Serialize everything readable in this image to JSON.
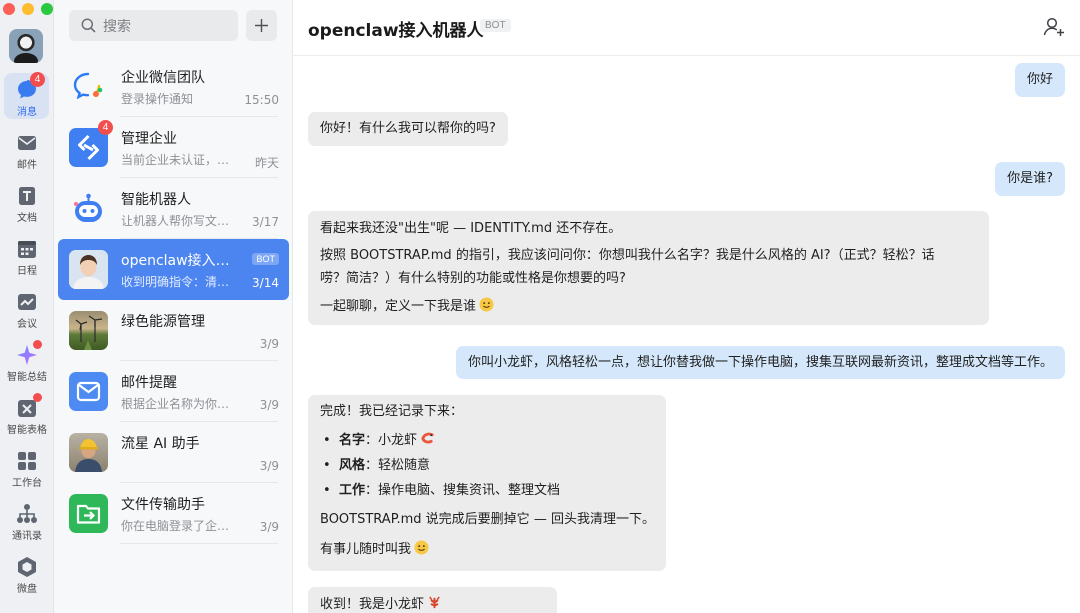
{
  "window": {
    "controls": [
      "close",
      "minimize",
      "maximize"
    ]
  },
  "nav": {
    "items": [
      {
        "id": "messages",
        "label": "消息",
        "icon": "chat-bubble-icon",
        "badge": "4",
        "active": true
      },
      {
        "id": "mail",
        "label": "邮件",
        "icon": "mail-icon"
      },
      {
        "id": "docs",
        "label": "文档",
        "icon": "document-icon"
      },
      {
        "id": "calendar",
        "label": "日程",
        "icon": "calendar-icon"
      },
      {
        "id": "meeting",
        "label": "会议",
        "icon": "meeting-icon"
      },
      {
        "id": "ai-summary",
        "label": "智能总结",
        "icon": "sparkle-icon",
        "dot": true
      },
      {
        "id": "smart-sheet",
        "label": "智能表格",
        "icon": "smart-sheet-icon",
        "dot": true
      },
      {
        "id": "workbench",
        "label": "工作台",
        "icon": "grid-icon"
      },
      {
        "id": "contacts",
        "label": "通讯录",
        "icon": "org-chart-icon"
      },
      {
        "id": "drive",
        "label": "微盘",
        "icon": "drive-icon"
      }
    ]
  },
  "search": {
    "placeholder": "搜索"
  },
  "chats": [
    {
      "name": "企业微信团队",
      "preview": "登录操作通知",
      "time": "15:50",
      "avatar": "wecom-logo-icon"
    },
    {
      "name": "管理企业",
      "preview": "当前企业未认证，…",
      "time": "昨天",
      "avatar": "manage-enterprise-icon",
      "badge": "4"
    },
    {
      "name": "智能机器人",
      "preview": "让机器人帮你写文…",
      "time": "3/17",
      "avatar": "robot-icon"
    },
    {
      "name": "openclaw接入机…",
      "preview": "收到明确指令：清…",
      "time": "3/14",
      "avatar": "portrait-avatar",
      "tag": "BOT",
      "selected": true
    },
    {
      "name": "绿色能源管理",
      "preview": "",
      "time": "3/9",
      "avatar": "wind-turbine-photo"
    },
    {
      "name": "邮件提醒",
      "preview": "根据企业名称为你推…",
      "time": "3/9",
      "avatar": "mail-reminder-icon"
    },
    {
      "name": "流星 AI 助手",
      "preview": "",
      "time": "3/9",
      "avatar": "worker-photo"
    },
    {
      "name": "文件传输助手",
      "preview": "你在电脑登录了企业…",
      "time": "3/9",
      "avatar": "file-transfer-icon"
    }
  ],
  "conversation": {
    "title": "openclaw接入机器人",
    "tag": "BOT",
    "messages": [
      {
        "from": "user",
        "text": "你好"
      },
      {
        "from": "bot",
        "text": "你好！有什么我可以帮你的吗?"
      },
      {
        "from": "user",
        "text": "你是谁?"
      },
      {
        "from": "bot",
        "paragraphs": [
          "看起来我还没\"出生\"呢 — IDENTITY.md 还不存在。",
          "按照 BOOTSTRAP.md 的指引，我应该问问你：你想叫我什么名字？我是什么风格的 AI?（正式？轻松？话",
          "唠？简洁？）有什么特别的功能或性格是你想要的吗?",
          "一起聊聊，定义一下我是谁"
        ]
      },
      {
        "from": "user",
        "text": "你叫小龙虾，风格轻松一点，想让你替我做一下操作电脑，搜集互联网最新资讯，整理成文档等工作。"
      },
      {
        "from": "bot",
        "intro": "完成！我已经记录下来：",
        "items": [
          {
            "key": "名字",
            "value": "：小龙虾"
          },
          {
            "key": "风格",
            "value": "：轻松随意"
          },
          {
            "key": "工作",
            "value": "：操作电脑、搜集资讯、整理文档"
          }
        ],
        "after": "BOOTSTRAP.md 说完成后要删掉它 — 回头我清理一下。",
        "closing": "有事儿随时叫我"
      },
      {
        "from": "bot",
        "text": "收到！我是小龙虾"
      }
    ]
  },
  "colors": {
    "accent": "#4c85f0",
    "user_bubble": "#d5e8fb",
    "bot_bubble": "#ececec",
    "badge": "#f24e4e"
  }
}
